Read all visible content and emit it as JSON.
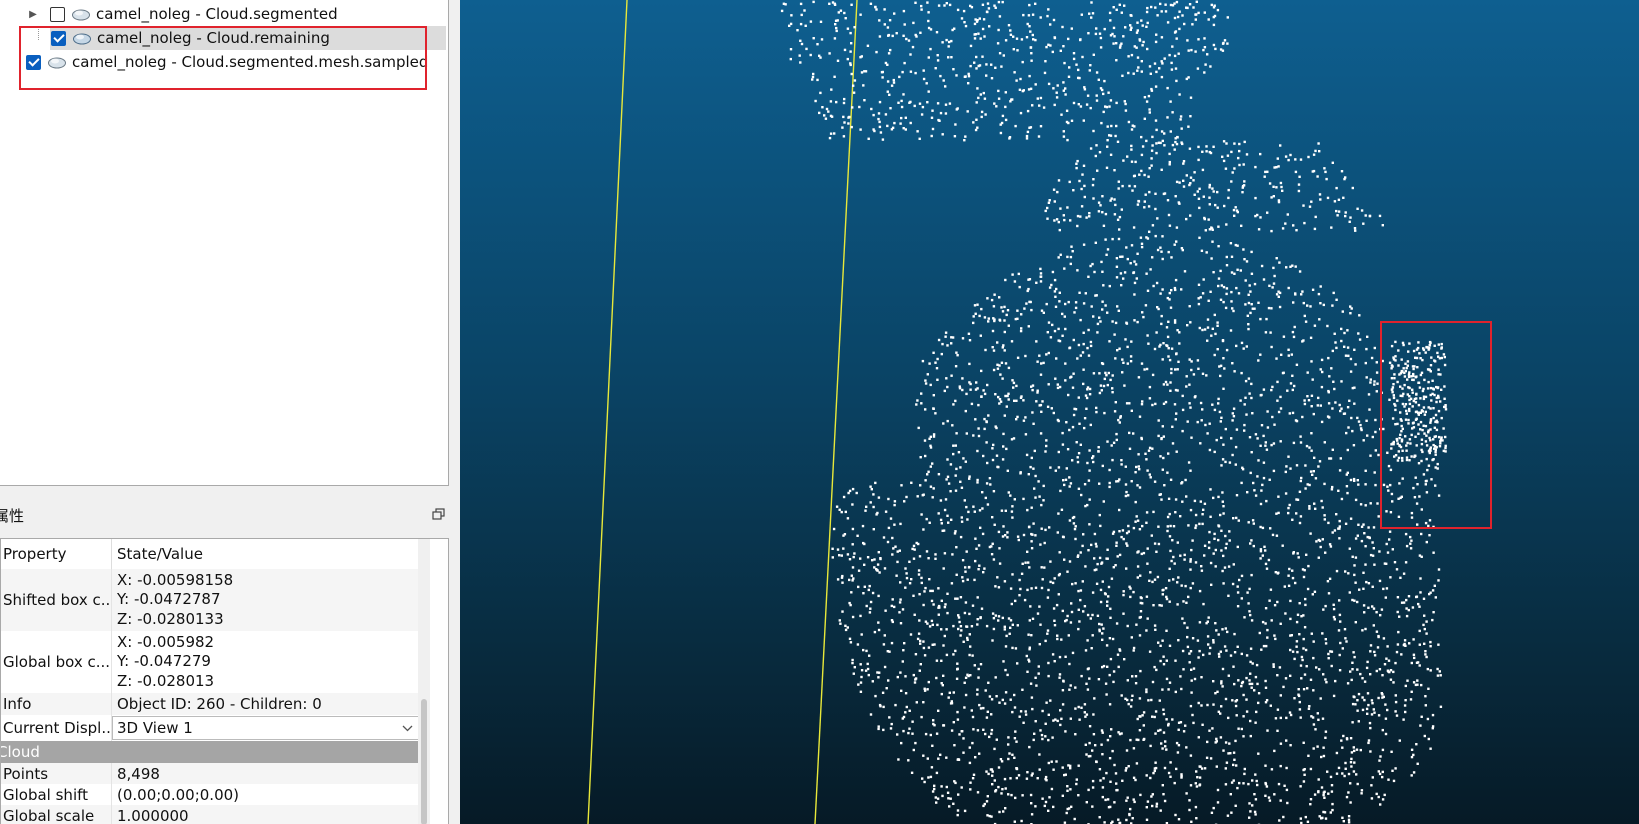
{
  "tree": {
    "items": [
      {
        "label": "camel_noleg - Cloud.segmented",
        "checked": false,
        "expandable": true,
        "icon": "cloud-icon"
      },
      {
        "label": "camel_noleg - Cloud.remaining",
        "checked": true,
        "expandable": false,
        "icon": "cloud-icon",
        "selected": true
      },
      {
        "label": "camel_noleg - Cloud.segmented.mesh.sampled",
        "checked": true,
        "expandable": false,
        "icon": "cloud-icon"
      }
    ]
  },
  "properties": {
    "title": "属性",
    "header": {
      "property": "Property",
      "value": "State/Value"
    },
    "shifted_box": {
      "name": "Shifted box c...",
      "x": "X: -0.00598158",
      "y": "Y: -0.0472787",
      "z": "Z: -0.0280133"
    },
    "global_box": {
      "name": "Global box c...",
      "x": "X: -0.005982",
      "y": "Y: -0.047279",
      "z": "Z: -0.028013"
    },
    "info": {
      "name": "Info",
      "value": "Object ID: 260 - Children: 0"
    },
    "current_display": {
      "name": "Current Displ...",
      "value": "3D View 1"
    },
    "section_cloud": "Cloud",
    "points": {
      "name": "Points",
      "value": "8,498"
    },
    "global_shift": {
      "name": "Global shift",
      "value": "(0.00;0.00;0.00)"
    },
    "global_scale": {
      "name": "Global scale",
      "value": "1.000000"
    }
  },
  "colors": {
    "highlight_box": "#e0232d",
    "checkbox_checked": "#0a5fbf",
    "viewport_top": "#0e5f90",
    "viewport_bottom": "#061a26",
    "point": "#ffffff",
    "guide_line": "#e8e83a"
  }
}
